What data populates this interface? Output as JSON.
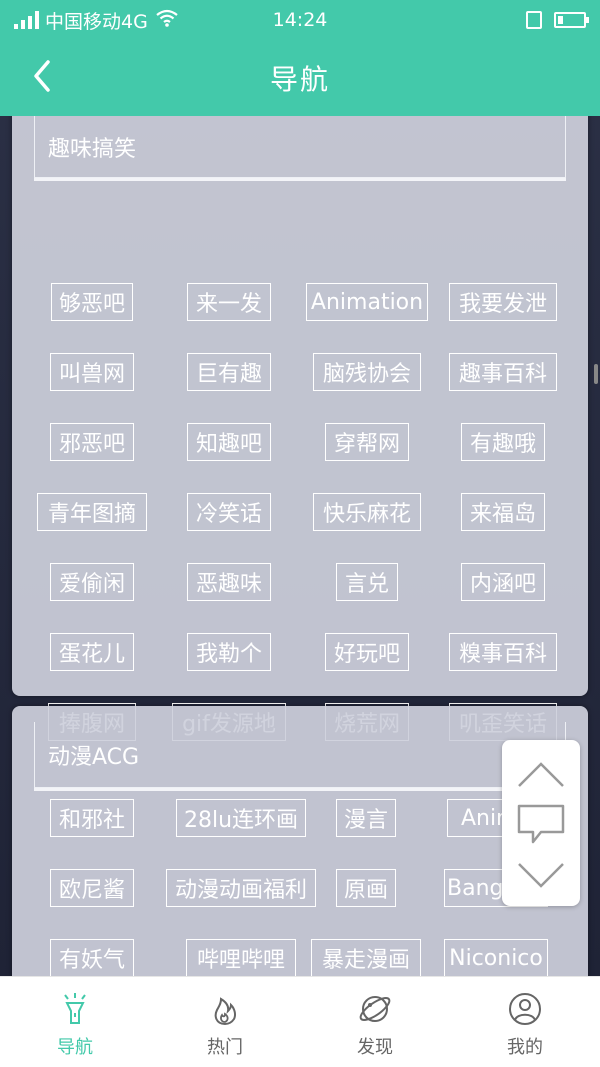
{
  "status_bar": {
    "carrier": "中国移动4G",
    "time": "14:24"
  },
  "header": {
    "title": "导航",
    "back_icon": "chevron-left-icon"
  },
  "sections": [
    {
      "title": "趣味搞笑",
      "items": [
        "够恶吧",
        "来一发",
        "Animation",
        "我要发泄",
        "叫兽网",
        "巨有趣",
        "脑残协会",
        "趣事百科",
        "邪恶吧",
        "知趣吧",
        "穿帮网",
        "有趣哦",
        "青年图摘",
        "冷笑话",
        "快乐麻花",
        "来福岛",
        "爱偷闲",
        "恶趣味",
        "言兑",
        "内涵吧",
        "蛋花儿",
        "我勒个",
        "好玩吧",
        "糗事百科",
        "捧腹网",
        "gif发源地",
        "烧荒网",
        "叽歪笑话"
      ]
    },
    {
      "title": "动漫ACG",
      "items": [
        "和邪社",
        "28lu连环画",
        "漫言",
        "Anime",
        "欧尼酱",
        "动漫动画福利",
        "原画",
        "Bangumi",
        "有妖气",
        "哔哩哔哩",
        "暴走漫画",
        "Niconico"
      ]
    }
  ],
  "float_panel": {
    "up_icon": "chevron-up-icon",
    "comment_icon": "speech-bubble-icon",
    "down_icon": "chevron-down-icon"
  },
  "tabs": [
    {
      "label": "导航",
      "icon": "flashlight-icon",
      "active": true
    },
    {
      "label": "热门",
      "icon": "flame-icon",
      "active": false
    },
    {
      "label": "发现",
      "icon": "planet-icon",
      "active": false
    },
    {
      "label": "我的",
      "icon": "user-icon",
      "active": false
    }
  ],
  "colors": {
    "accent": "#43c9aa",
    "tab_inactive": "#666666"
  }
}
